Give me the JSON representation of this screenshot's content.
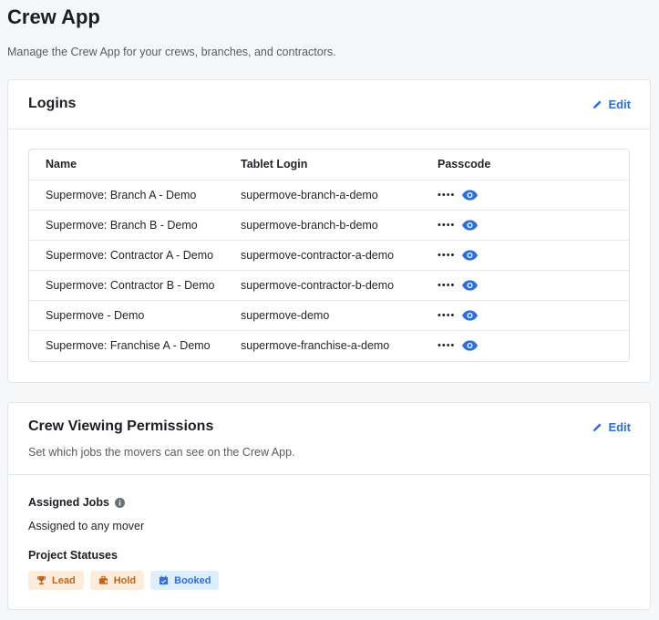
{
  "page": {
    "title": "Crew App",
    "subtitle": "Manage the Crew App for your crews, branches, and contractors."
  },
  "logins": {
    "title": "Logins",
    "edit_label": "Edit",
    "columns": [
      "Name",
      "Tablet Login",
      "Passcode"
    ],
    "rows": [
      {
        "name": "Supermove: Branch A - Demo",
        "login": "supermove-branch-a-demo",
        "passcode": "••••"
      },
      {
        "name": "Supermove: Branch B - Demo",
        "login": "supermove-branch-b-demo",
        "passcode": "••••"
      },
      {
        "name": "Supermove: Contractor A - Demo",
        "login": "supermove-contractor-a-demo",
        "passcode": "••••"
      },
      {
        "name": "Supermove: Contractor B - Demo",
        "login": "supermove-contractor-b-demo",
        "passcode": "••••"
      },
      {
        "name": "Supermove - Demo",
        "login": "supermove-demo",
        "passcode": "••••"
      },
      {
        "name": "Supermove: Franchise A - Demo",
        "login": "supermove-franchise-a-demo",
        "passcode": "••••"
      }
    ]
  },
  "permissions": {
    "title": "Crew Viewing Permissions",
    "edit_label": "Edit",
    "description": "Set which jobs the movers can see on the Crew App.",
    "assigned_jobs_label": "Assigned Jobs",
    "assigned_jobs_value": "Assigned to any mover",
    "project_statuses_label": "Project Statuses",
    "statuses": [
      {
        "label": "Lead",
        "icon": "trophy-icon",
        "color": "#c2641a"
      },
      {
        "label": "Hold",
        "icon": "briefcase-icon",
        "color": "#c2641a"
      },
      {
        "label": "Booked",
        "icon": "calendar-check-icon",
        "color": "#2f6fd7"
      }
    ]
  },
  "colors": {
    "accent": "#2f6fd7",
    "warning_bg": "#fdecd9",
    "info_bg": "#ddeefc"
  }
}
